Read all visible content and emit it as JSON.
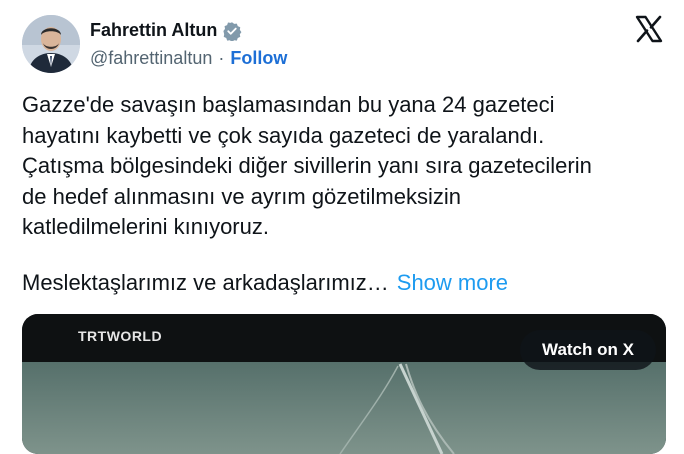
{
  "author": {
    "name": "Fahrettin Altun",
    "handle": "@fahrettinaltun",
    "separator": "·",
    "follow_label": "Follow"
  },
  "icons": {
    "verified": "verified-badge-icon",
    "brand": "x-logo-icon"
  },
  "tweet": {
    "text": "Gazze'de savaşın başlamasından bu yana 24 gazeteci\nhayatını kaybetti ve çok sayıda gazeteci de yaralandı.\nÇatışma bölgesindeki diğer sivillerin yanı sıra gazetecilerin\nde hedef alınmasını ve ayrım gözetilmeksizin\nkatledilmelerini kınıyoruz.",
    "truncated_line": "Meslektaşlarımız ve arkadaşlarımız…",
    "show_more_label": "Show more"
  },
  "media": {
    "brand_label": "TRTWORLD",
    "watch_label": "Watch on X"
  },
  "colors": {
    "link": "#1d9bf0",
    "follow": "#1d6fd6",
    "verified": "#829aab",
    "text": "#0f1419",
    "secondary": "#536471"
  }
}
